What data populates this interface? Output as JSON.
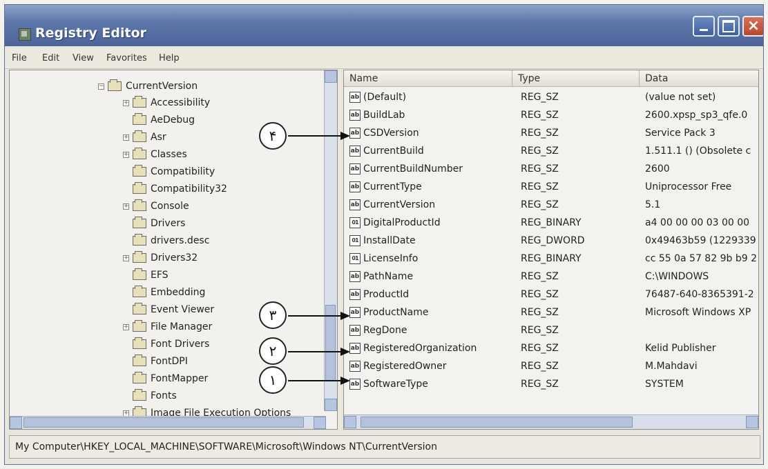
{
  "window": {
    "title": "Registry Editor"
  },
  "menu": [
    "File",
    "Edit",
    "View",
    "Favorites",
    "Help"
  ],
  "tree": {
    "current": "CurrentVersion",
    "items": [
      {
        "label": "Accessibility",
        "expandable": true
      },
      {
        "label": "AeDebug",
        "expandable": false
      },
      {
        "label": "Asr",
        "expandable": true
      },
      {
        "label": "Classes",
        "expandable": true
      },
      {
        "label": "Compatibility",
        "expandable": false
      },
      {
        "label": "Compatibility32",
        "expandable": false
      },
      {
        "label": "Console",
        "expandable": true
      },
      {
        "label": "Drivers",
        "expandable": false
      },
      {
        "label": "drivers.desc",
        "expandable": false
      },
      {
        "label": "Drivers32",
        "expandable": true
      },
      {
        "label": "EFS",
        "expandable": false
      },
      {
        "label": "Embedding",
        "expandable": false
      },
      {
        "label": "Event Viewer",
        "expandable": false
      },
      {
        "label": "File Manager",
        "expandable": true
      },
      {
        "label": "Font Drivers",
        "expandable": false
      },
      {
        "label": "FontDPI",
        "expandable": false
      },
      {
        "label": "FontMapper",
        "expandable": false
      },
      {
        "label": "Fonts",
        "expandable": false
      },
      {
        "label": "Image File Execution Options",
        "expandable": true
      }
    ]
  },
  "list": {
    "headers": [
      "Name",
      "Type",
      "Data"
    ],
    "rows": [
      {
        "name": "(Default)",
        "type": "REG_SZ",
        "data": "(value not set)",
        "icon": "ab"
      },
      {
        "name": "BuildLab",
        "type": "REG_SZ",
        "data": "2600.xpsp_sp3_qfe.0",
        "icon": "ab"
      },
      {
        "name": "CSDVersion",
        "type": "REG_SZ",
        "data": "Service Pack 3",
        "icon": "ab"
      },
      {
        "name": "CurrentBuild",
        "type": "REG_SZ",
        "data": "1.511.1 () (Obsolete c",
        "icon": "ab"
      },
      {
        "name": "CurrentBuildNumber",
        "type": "REG_SZ",
        "data": "2600",
        "icon": "ab"
      },
      {
        "name": "CurrentType",
        "type": "REG_SZ",
        "data": "Uniprocessor Free",
        "icon": "ab"
      },
      {
        "name": "CurrentVersion",
        "type": "REG_SZ",
        "data": "5.1",
        "icon": "ab"
      },
      {
        "name": "DigitalProductId",
        "type": "REG_BINARY",
        "data": "a4 00 00 00 03 00 00",
        "icon": "bin"
      },
      {
        "name": "InstallDate",
        "type": "REG_DWORD",
        "data": "0x49463b59 (1229339",
        "icon": "bin"
      },
      {
        "name": "LicenseInfo",
        "type": "REG_BINARY",
        "data": "cc 55 0a 57 82 9b b9 2",
        "icon": "bin"
      },
      {
        "name": "PathName",
        "type": "REG_SZ",
        "data": "C:\\WINDOWS",
        "icon": "ab"
      },
      {
        "name": "ProductId",
        "type": "REG_SZ",
        "data": "76487-640-8365391-2",
        "icon": "ab"
      },
      {
        "name": "ProductName",
        "type": "REG_SZ",
        "data": "Microsoft Windows XP",
        "icon": "ab"
      },
      {
        "name": "RegDone",
        "type": "REG_SZ",
        "data": "",
        "icon": "ab"
      },
      {
        "name": "RegisteredOrganization",
        "type": "REG_SZ",
        "data": "Kelid Publisher",
        "icon": "ab"
      },
      {
        "name": "RegisteredOwner",
        "type": "REG_SZ",
        "data": "M.Mahdavi",
        "icon": "ab"
      },
      {
        "name": "SoftwareType",
        "type": "REG_SZ",
        "data": "SYSTEM",
        "icon": "ab"
      }
    ]
  },
  "callouts": {
    "c4": "۴",
    "c3": "۳",
    "c2": "۲",
    "c1": "۱"
  },
  "status": {
    "path": "My Computer\\HKEY_LOCAL_MACHINE\\SOFTWARE\\Microsoft\\Windows NT\\CurrentVersion"
  }
}
